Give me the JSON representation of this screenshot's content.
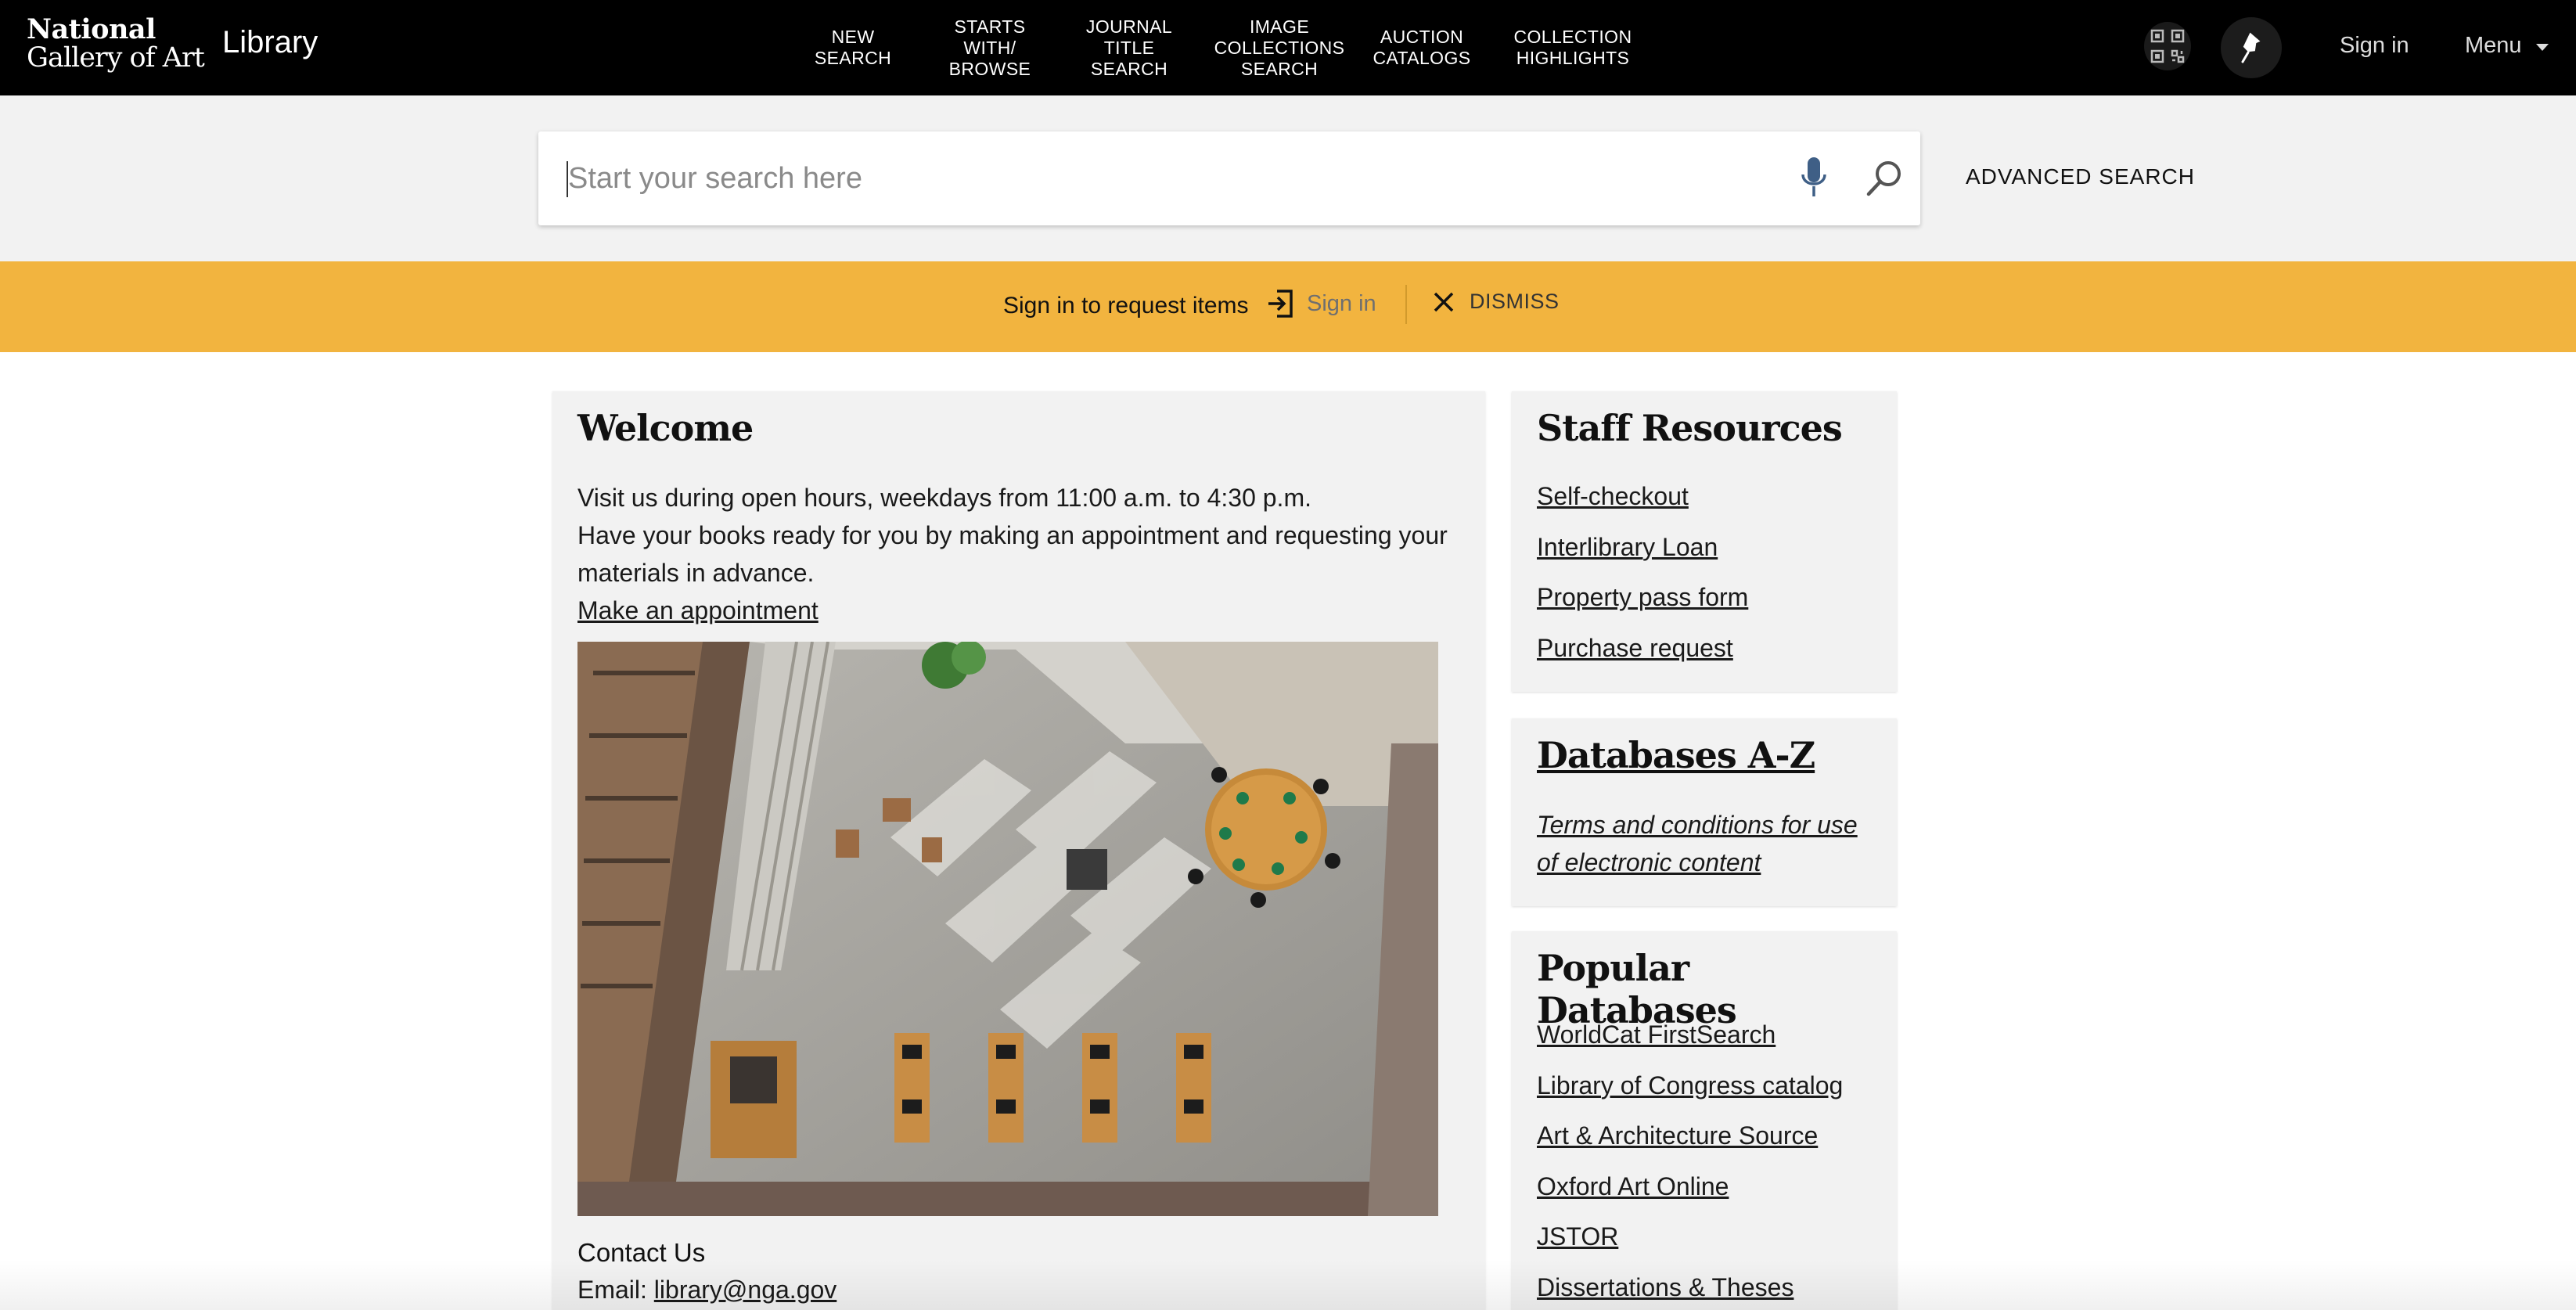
{
  "header": {
    "logo_line1": "National",
    "logo_line2": "Gallery of Art",
    "library_title": "Library",
    "nav": [
      {
        "label": "NEW\nSEARCH"
      },
      {
        "label": "STARTS\nWITH/\nBROWSE"
      },
      {
        "label": "JOURNAL\nTITLE\nSEARCH"
      },
      {
        "label": "IMAGE\nCOLLECTIONS\nSEARCH"
      },
      {
        "label": "AUCTION\nCATALOGS"
      },
      {
        "label": "COLLECTION\nHIGHLIGHTS"
      }
    ],
    "sign_in": "Sign in",
    "menu": "Menu"
  },
  "search": {
    "placeholder": "Start your search here",
    "value": "",
    "advanced": "ADVANCED SEARCH"
  },
  "banner": {
    "message": "Sign in to request items",
    "sign_in": "Sign in",
    "dismiss": "DISMISS"
  },
  "welcome": {
    "title": "Welcome",
    "line1": "Visit us during open hours, weekdays from 11:00 a.m. to 4:30 p.m.",
    "line2": "Have your books ready for you by making an appointment and requesting your materials in advance.",
    "appointment_link": "Make an appointment",
    "contact_heading": "Contact Us",
    "email_label": "Email: ",
    "email": "library@nga.gov"
  },
  "staff_resources": {
    "title": "Staff Resources",
    "links": [
      "Self-checkout",
      "Interlibrary Loan",
      "Property pass form",
      "Purchase request"
    ]
  },
  "databases_az": {
    "title": "Databases A-Z",
    "terms": "Terms and conditions for use of electronic content"
  },
  "popular_databases": {
    "title": "Popular Databases",
    "links": [
      "WorldCat FirstSearch",
      "Library of Congress catalog",
      "Art & Architecture Source",
      "Oxford Art Online",
      "JSTOR",
      "Dissertations & Theses"
    ]
  },
  "colors": {
    "topbar": "#000000",
    "banner": "#f2b43f",
    "panel": "#f2f2f2",
    "mic": "#3f5f86"
  }
}
